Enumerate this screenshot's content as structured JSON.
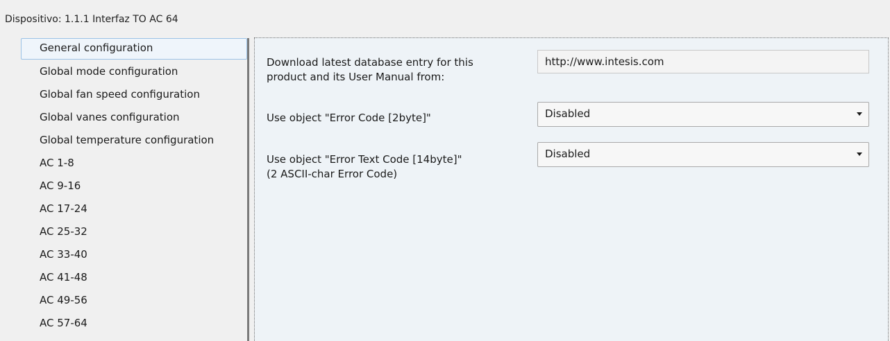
{
  "window": {
    "title": "Dispositivo: 1.1.1  Interfaz TO AC 64"
  },
  "sidebar": {
    "items": [
      {
        "label": "General configuration",
        "selected": true
      },
      {
        "label": "Global mode configuration",
        "selected": false
      },
      {
        "label": "Global fan speed configuration",
        "selected": false
      },
      {
        "label": "Global vanes configuration",
        "selected": false
      },
      {
        "label": "Global temperature configuration",
        "selected": false
      },
      {
        "label": "AC 1-8",
        "selected": false
      },
      {
        "label": "AC 9-16",
        "selected": false
      },
      {
        "label": "AC 17-24",
        "selected": false
      },
      {
        "label": "AC 25-32",
        "selected": false
      },
      {
        "label": "AC 33-40",
        "selected": false
      },
      {
        "label": "AC 41-48",
        "selected": false
      },
      {
        "label": "AC 49-56",
        "selected": false
      },
      {
        "label": "AC 57-64",
        "selected": false
      }
    ]
  },
  "params": {
    "download": {
      "label_line1": "Download latest database entry for this",
      "label_line2": "product and its User Manual from:",
      "value": "http://www.intesis.com"
    },
    "error_code": {
      "label": "Use object \"Error Code [2byte]\"",
      "value": "Disabled"
    },
    "error_text_code": {
      "label_line1": "Use object \"Error Text Code [14byte]\"",
      "label_line2": "(2 ASCII-char Error Code)",
      "value": "Disabled"
    }
  },
  "colors": {
    "content_background": "#eef3f7",
    "selected_item_border": "#9cc2e6",
    "splitter": "#7a7a7a"
  },
  "icons": {
    "dropdown": "chevron-down-icon"
  }
}
